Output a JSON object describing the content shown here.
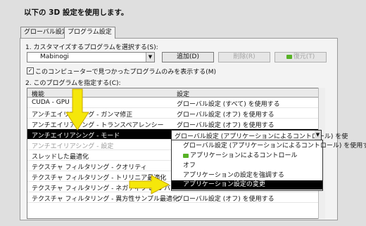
{
  "heading": "以下の 3D 設定を使用します。",
  "tabs": [
    {
      "label": "グローバル設定"
    },
    {
      "label": "プログラム設定"
    }
  ],
  "program_select_label": "1. カスタマイズするプログラムを選択する(S):",
  "program_value": "Mabinogi",
  "buttons": {
    "add": "追加(D)",
    "remove": "削除(R)",
    "restore": "復元(T)"
  },
  "only_found_checkbox": "このコンピューターで見つかったプログラムのみを表示する(M)",
  "specify_label": "2. このプログラムを指定する(C):",
  "table_headers": {
    "feature": "機能",
    "setting": "設定"
  },
  "rows": [
    {
      "feature": "CUDA - GPU",
      "setting": "グローバル設定 (すべて) を使用する"
    },
    {
      "feature": "アンチエイリアシング - ガンマ修正",
      "setting": "グローバル設定 (オフ) を使用する"
    },
    {
      "feature": "アンチエイリアシング - トランスペアレンシー",
      "setting": "グローバル設定 (オフ) を使用する"
    },
    {
      "feature": "アンチエイリアシング - モード",
      "setting": ""
    },
    {
      "feature": "アンチエイリアシング - 設定",
      "setting": ""
    },
    {
      "feature": "スレッドした最適化",
      "setting": ""
    },
    {
      "feature": "テクスチャ フィルタリング - クオリティ",
      "setting": ""
    },
    {
      "feature": "テクスチャ フィルタリング - トリリニア最適化",
      "setting": ""
    },
    {
      "feature": "テクスチャ フィルタリング - ネガティブ LOD バイアス",
      "setting": ""
    },
    {
      "feature": "テクスチャ フィルタリング - 異方性サンプル最適化",
      "setting": "グローバル設定 (オフ) を使用する"
    }
  ],
  "combo_value": "グローバル設定 (アプリケーションによるコントロール) を使",
  "dropdown_options": [
    {
      "label": "グローバル設定 (アプリケーションによるコントロール) を使用する",
      "highlighted": false
    },
    {
      "label": "アプリケーションによるコントロール",
      "highlighted": false
    },
    {
      "label": "オフ",
      "highlighted": false
    },
    {
      "label": "アプリケーションの設定を強調する",
      "highlighted": false
    },
    {
      "label": "アプリケーション設定の変更",
      "highlighted": true
    }
  ],
  "colors": {
    "arrow": "#f5e70a",
    "nvidia": "#57b226"
  }
}
